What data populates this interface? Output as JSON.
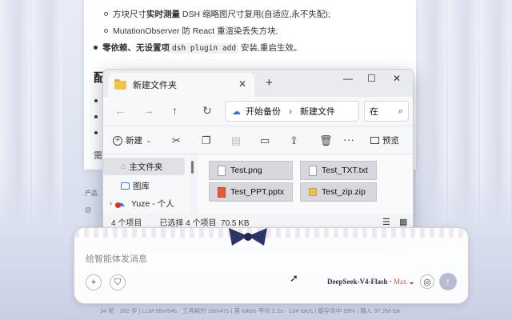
{
  "document": {
    "bullet1": "方块尺寸实时测量 DSH 缩略图尺寸复用(自适应,永不失配);",
    "bullet1_bold": "实时测量",
    "bullet1_pre": "方块尺寸",
    "bullet1_post": " DSH 缩略图尺寸复用(自适应,永不失配);",
    "bullet2": "MutationObserver 防 React 重渲染丢失方块;",
    "bullet3_bold": "零依赖、无设置项",
    "bullet3_code": "dsh plugin add",
    "bullet3_post": " 安装,重启生效。",
    "heading": "配",
    "tail": "需"
  },
  "side_labels": [
    "产品",
    "@"
  ],
  "explorer": {
    "tab_title": "新建文件夹",
    "tab_close": "✕",
    "new_tab": "+",
    "window_controls": [
      "—",
      "☐",
      "✕"
    ],
    "breadcrumb_root": "开始备份",
    "breadcrumb_current": "新建文件",
    "search_placeholder": "在",
    "toolbar_new": "新建",
    "toolbar_preview": "预览",
    "sidebar": [
      {
        "label": "主文件夹",
        "icon": "home-icon",
        "selected": true
      },
      {
        "label": "图库",
        "icon": "gallery-icon",
        "selected": false
      },
      {
        "label": "Yuze - 个人",
        "icon": "cloud-icon",
        "selected": false
      }
    ],
    "files": [
      {
        "name": "Test.png",
        "type": "png"
      },
      {
        "name": "Test_TXT.txt",
        "type": "txt"
      },
      {
        "name": "Test_PPT.pptx",
        "type": "pptx"
      },
      {
        "name": "Test_zip.zip",
        "type": "zip"
      }
    ],
    "status_count": "4 个项目",
    "status_selected": "已选择 4 个项目  70.5 KB"
  },
  "chat": {
    "placeholder": "给智能体发消息",
    "model_name": "DeepSeek-V4-Flash · ",
    "model_tier": "Max",
    "model_arrow": "⌄"
  },
  "stats": "34 轮 · 282 步   |   LLM 55m54s · 工具耗时 16m47s   |   首 token 平均 2.2s · 124 tok/s   |   缓存命中 99%   |   输入 97.2M tok ·"
}
